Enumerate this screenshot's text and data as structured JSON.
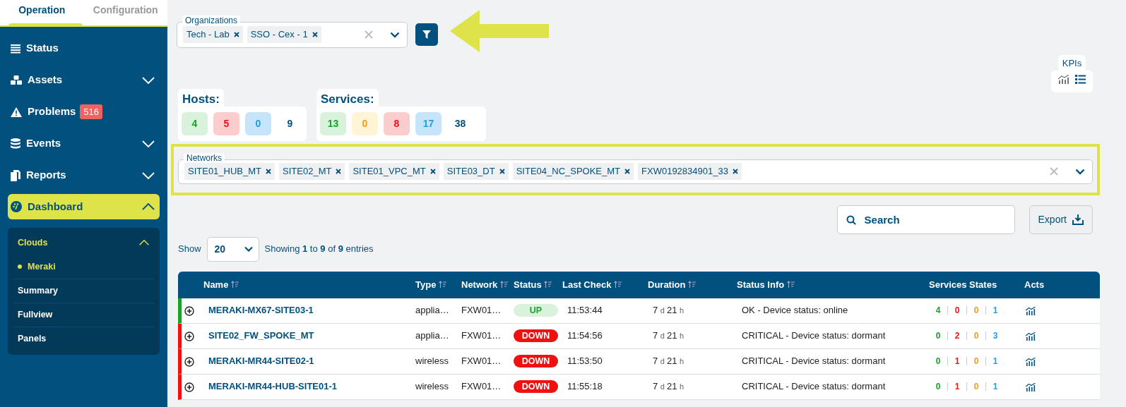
{
  "sidebar": {
    "tabs": [
      {
        "label": "Operation",
        "selected": true
      },
      {
        "label": "Configuration",
        "selected": false
      }
    ],
    "items": [
      {
        "label": "Status",
        "selected": false
      },
      {
        "label": "Assets",
        "selected": false,
        "expanded": false
      },
      {
        "label": "Problems",
        "selected": false,
        "badge": "516"
      },
      {
        "label": "Events",
        "selected": false,
        "expanded": false
      },
      {
        "label": "Reports",
        "selected": false,
        "expanded": false
      },
      {
        "label": "Dashboard",
        "selected": true,
        "expanded": true,
        "children": [
          {
            "label": "Clouds",
            "expanded": true,
            "children": [
              {
                "label": "Meraki",
                "selected": true
              }
            ]
          },
          {
            "label": "Summary",
            "selected": false
          },
          {
            "label": "Fullview",
            "selected": false
          },
          {
            "label": "Panels",
            "selected": false
          }
        ]
      }
    ]
  },
  "organizations": {
    "label": "Organizations",
    "tags": [
      "Tech - Lab",
      "SSO - Cex - 1"
    ]
  },
  "kpis": {
    "label": "KPIs"
  },
  "hosts": {
    "label": "Hosts:",
    "counts": [
      {
        "value": "4",
        "kind": "ok"
      },
      {
        "value": "5",
        "kind": "critical"
      },
      {
        "value": "0",
        "kind": "unknown"
      },
      {
        "value": "9",
        "kind": "total"
      }
    ]
  },
  "services": {
    "label": "Services:",
    "counts": [
      {
        "value": "13",
        "kind": "ok"
      },
      {
        "value": "0",
        "kind": "warning"
      },
      {
        "value": "8",
        "kind": "critical"
      },
      {
        "value": "17",
        "kind": "unknown"
      },
      {
        "value": "38",
        "kind": "total"
      }
    ]
  },
  "networks": {
    "label": "Networks",
    "tags": [
      "SITE01_HUB_MT",
      "SITE02_MT",
      "SITE01_VPC_MT",
      "SITE03_DT",
      "SITE04_NC_SPOKE_MT",
      "FXW0192834901_33"
    ]
  },
  "search": {
    "placeholder": "Search"
  },
  "export": {
    "label": "Export"
  },
  "show": {
    "label": "Show",
    "value": "20",
    "info": "Showing **1** to **9** of **9** entries"
  },
  "table": {
    "columns": [
      {
        "label": "Name",
        "sortable": true
      },
      {
        "label": "Type",
        "sortable": true
      },
      {
        "label": "Network",
        "sortable": true
      },
      {
        "label": "Status",
        "sortable": true
      },
      {
        "label": "Last Check",
        "sortable": true
      },
      {
        "label": "Duration",
        "sortable": true
      },
      {
        "label": "Status Info",
        "sortable": true
      },
      {
        "label": "Services States",
        "sortable": false
      },
      {
        "label": "Acts",
        "sortable": false
      }
    ],
    "rows": [
      {
        "up": true,
        "name": "MERAKI-MX67-SITE03-1",
        "type": "applia…",
        "network": "FXW01…",
        "status": "UP",
        "last_check": "11:53:44",
        "duration": {
          "days": "7",
          "day_unit": "d",
          "hours": "21",
          "hour_unit": "h"
        },
        "status_info": "OK - Device status: online",
        "services": [
          {
            "value": "4",
            "kind": "ok"
          },
          {
            "value": "0",
            "kind": "critical"
          },
          {
            "value": "0",
            "kind": "warning"
          },
          {
            "value": "1",
            "kind": "unknown"
          }
        ]
      },
      {
        "up": false,
        "name": "SITE02_FW_SPOKE_MT",
        "type": "applia…",
        "network": "FXW01…",
        "status": "DOWN",
        "last_check": "11:54:56",
        "duration": {
          "days": "7",
          "day_unit": "d",
          "hours": "21",
          "hour_unit": "h"
        },
        "status_info": "CRITICAL - Device status: dormant",
        "services": [
          {
            "value": "0",
            "kind": "ok"
          },
          {
            "value": "2",
            "kind": "critical"
          },
          {
            "value": "0",
            "kind": "warning"
          },
          {
            "value": "3",
            "kind": "unknown"
          }
        ]
      },
      {
        "up": false,
        "name": "MERAKI-MR44-SITE02-1",
        "type": "wireless",
        "network": "FXW01…",
        "status": "DOWN",
        "last_check": "11:53:50",
        "duration": {
          "days": "7",
          "day_unit": "d",
          "hours": "21",
          "hour_unit": "h"
        },
        "status_info": "CRITICAL - Device status: dormant",
        "services": [
          {
            "value": "0",
            "kind": "ok"
          },
          {
            "value": "1",
            "kind": "critical"
          },
          {
            "value": "0",
            "kind": "warning"
          },
          {
            "value": "1",
            "kind": "unknown"
          }
        ]
      },
      {
        "up": false,
        "name": "MERAKI-MR44-HUB-SITE01-1",
        "type": "wireless",
        "network": "FXW01…",
        "status": "DOWN",
        "last_check": "11:55:18",
        "duration": {
          "days": "7",
          "day_unit": "d",
          "hours": "21",
          "hour_unit": "h"
        },
        "status_info": "CRITICAL - Device status: dormant",
        "services": [
          {
            "value": "0",
            "kind": "ok"
          },
          {
            "value": "1",
            "kind": "critical"
          },
          {
            "value": "0",
            "kind": "warning"
          },
          {
            "value": "1",
            "kind": "unknown"
          }
        ]
      }
    ]
  }
}
